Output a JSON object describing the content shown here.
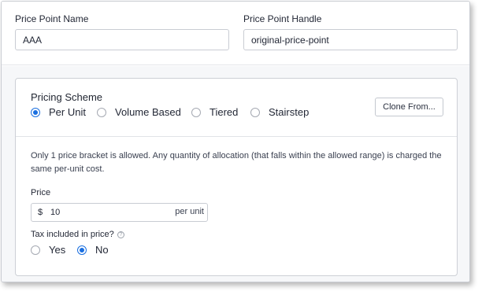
{
  "header": {
    "name_label": "Price Point Name",
    "name_value": "AAA",
    "handle_label": "Price Point Handle",
    "handle_value": "original-price-point"
  },
  "pricing": {
    "title": "Pricing Scheme",
    "options": [
      "Per Unit",
      "Volume Based",
      "Tiered",
      "Stairstep"
    ],
    "selected": "Per Unit",
    "clone_label": "Clone From...",
    "description": "Only 1 price bracket is allowed. Any quantity of allocation (that falls within the allowed range) is charged the same per-unit cost.",
    "price_label": "Price",
    "currency": "$",
    "price_value": "10",
    "unit_suffix": "per unit",
    "tax_label": "Tax included in price?",
    "tax_options": [
      "Yes",
      "No"
    ],
    "tax_selected": "No",
    "help_glyph": "?"
  },
  "colors": {
    "accent": "#1a6fe0",
    "border": "#c9ccd3",
    "panel_bg": "#f6f7f9"
  }
}
